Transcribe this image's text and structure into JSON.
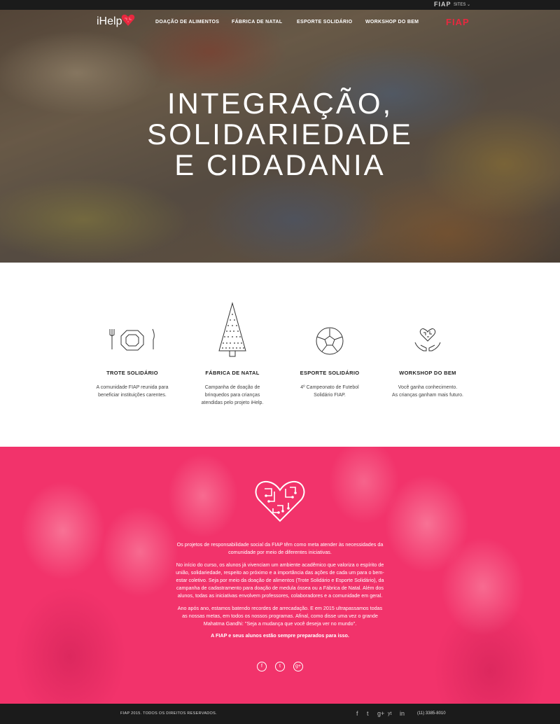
{
  "topbar": {
    "brand": "FIAP",
    "sites_label": "SITES"
  },
  "nav": {
    "logo": "iHelp",
    "items": [
      "DOAÇÃO DE ALIMENTOS",
      "FÁBRICA DE NATAL",
      "ESPORTE SOLIDÁRIO",
      "WORKSHOP DO BEM"
    ],
    "brand_right": "FIAP"
  },
  "hero": {
    "title_lines": [
      "INTEGRAÇÃO,",
      "SOLIDARIEDADE",
      "E CIDADANIA"
    ]
  },
  "features": [
    {
      "icon": "plate-cutlery-icon",
      "title": "TROTE SOLIDÁRIO",
      "desc_lines": [
        "A comunidade FIAP reunida para",
        "beneficiar instituições carentes."
      ]
    },
    {
      "icon": "christmas-tree-icon",
      "title": "FÁBRICA DE NATAL",
      "desc_lines": [
        "Campanha de doação de",
        "brinquedos para crianças",
        "atendidas pelo projeto iHelp."
      ]
    },
    {
      "icon": "soccer-ball-icon",
      "title": "ESPORTE SOLIDÁRIO",
      "desc_lines": [
        "4º Campeonato de Futebol",
        "Solidário FIAP."
      ]
    },
    {
      "icon": "hands-heart-icon",
      "title": "WORKSHOP DO BEM",
      "desc_lines": [
        "Você ganha conhecimento.",
        "As crianças ganham mais futuro."
      ]
    }
  ],
  "mission": {
    "p1": "Os projetos de responsabilidade social da FIAP têm como meta atender às necessidades da comunidade por meio de diferentes iniciativas.",
    "p2": "No início do curso, os alunos já vivenciam um ambiente acadêmico que valoriza o espírito de união, solidariedade, respeito ao próximo e a importância das ações de cada um para o bem-estar coletivo. Seja por meio da doação de alimentos (Trote Solidário e Esporte Solidário), da campanha de cadastramento para doação de medula óssea ou a Fábrica de Natal. Além dos alunos, todas as iniciativas envolvem professores, colaboradores e a comunidade em geral.",
    "p3": "Ano após ano, estamos batendo recordes de arrecadação. E em 2015 ultrapassamos todas as nossas metas, em todos os nossos programas. Afinal, como disse uma vez o grande Mahatma Gandhi: \"Seja a mudança que você deseja ver no mundo\".",
    "closing": "A FIAP e seus alunos estão sempre preparados para isso.",
    "social": [
      "f",
      "t",
      "g+"
    ]
  },
  "footer": {
    "copyright": "FIAP 2015. TODOS OS DIREITOS RESERVADOS.",
    "icons": [
      "f",
      "t",
      "g+",
      "yt",
      "in"
    ],
    "phone": "(11) 3385-8010"
  },
  "colors": {
    "pink": "#f2336b",
    "fiap_red": "#e8283f",
    "dark": "#1b1b1b"
  }
}
